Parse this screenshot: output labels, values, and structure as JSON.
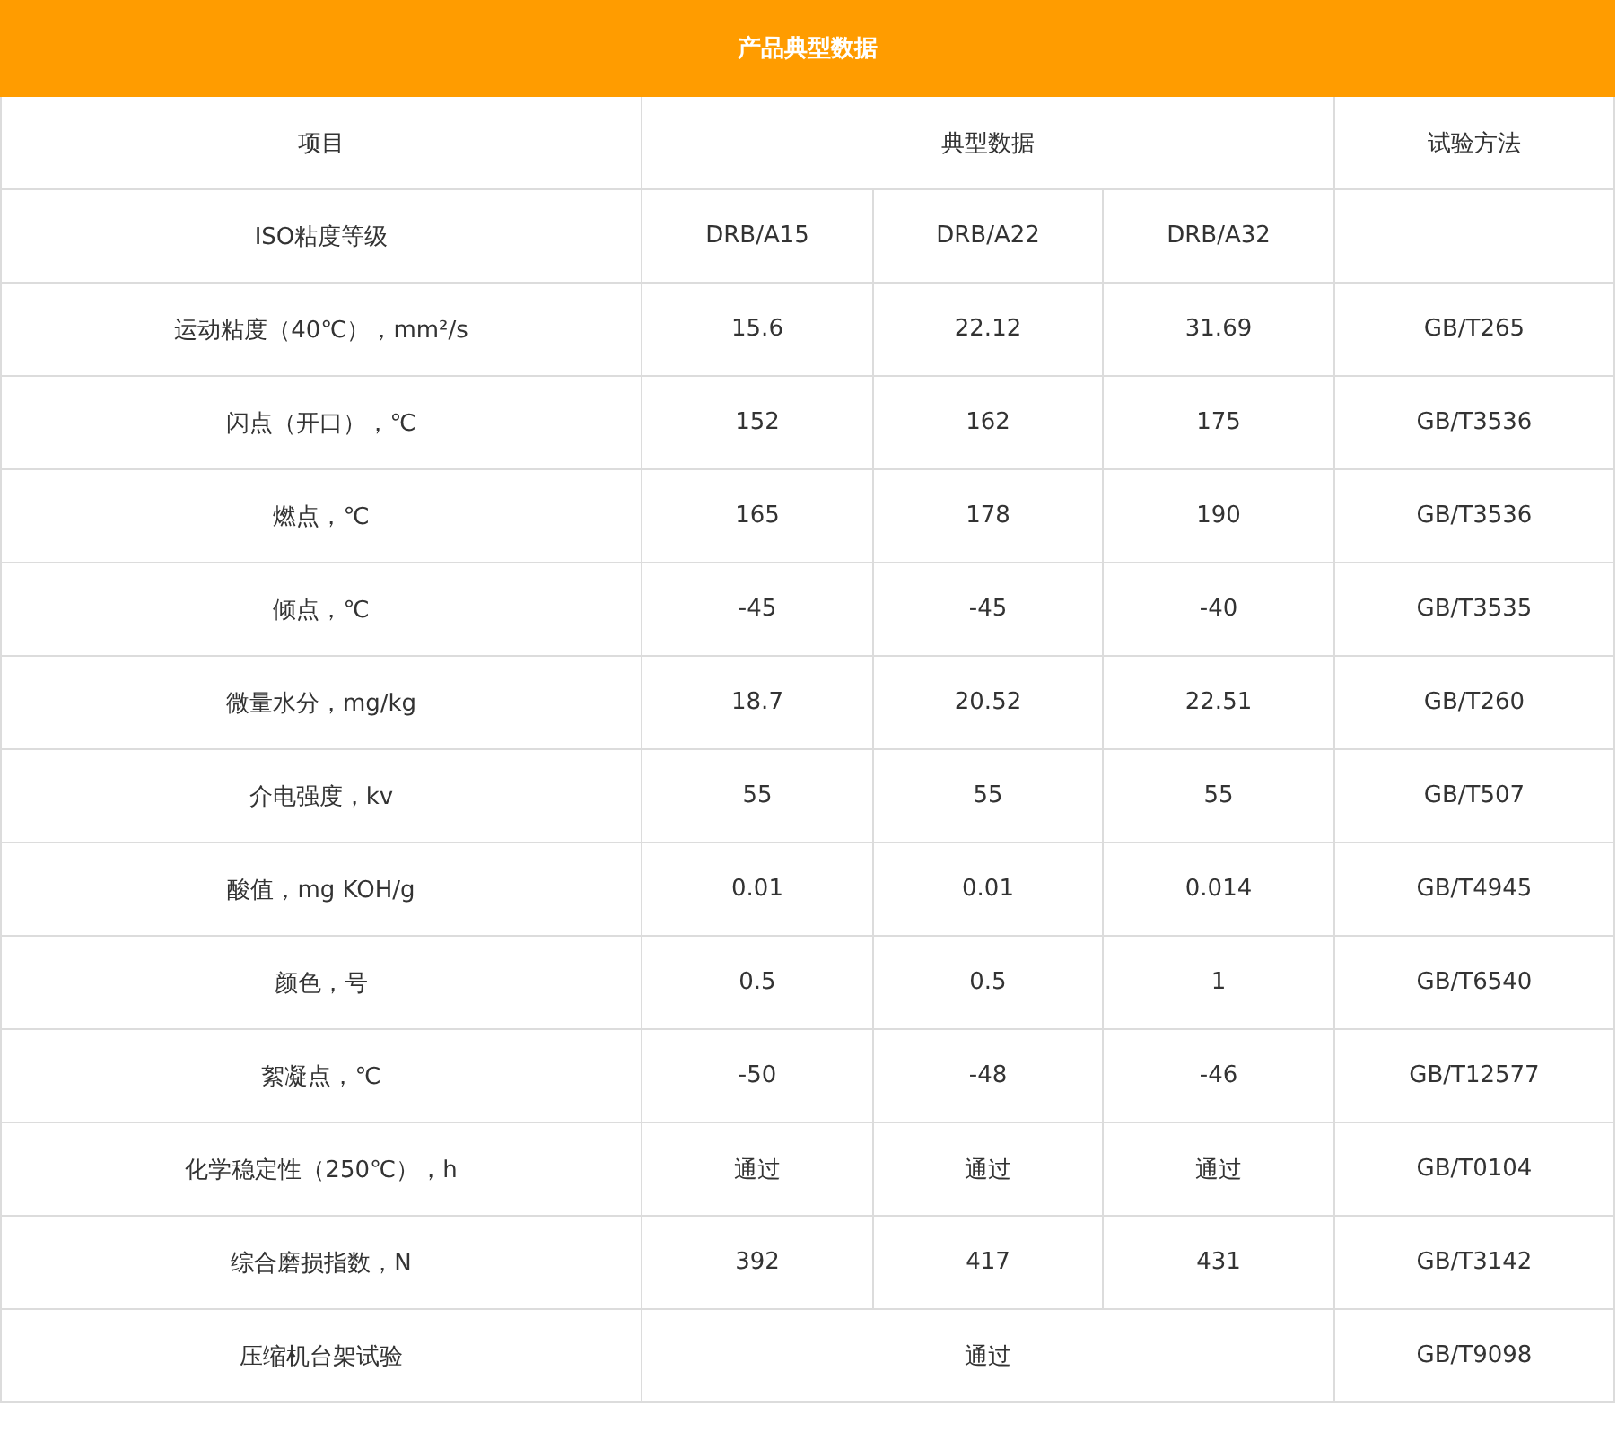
{
  "table": {
    "title": "产品典型数据",
    "header": {
      "item": "项目",
      "typical": "典型数据",
      "method": "试验方法"
    },
    "grades": {
      "label": "ISO粘度等级",
      "values": [
        "DRB/A15",
        "DRB/A22",
        "DRB/A32"
      ]
    },
    "rows": [
      {
        "kind": "values",
        "label": "运动粘度（40℃），mm²/s",
        "values": [
          "15.6",
          "22.12",
          "31.69"
        ],
        "method": "GB/T265"
      },
      {
        "kind": "values",
        "label": "闪点（开口），℃",
        "values": [
          "152",
          "162",
          "175"
        ],
        "method": "GB/T3536"
      },
      {
        "kind": "values",
        "label": "燃点，℃",
        "values": [
          "165",
          "178",
          "190"
        ],
        "method": "GB/T3536"
      },
      {
        "kind": "values",
        "label": "倾点，℃",
        "values": [
          "-45",
          "-45",
          "-40"
        ],
        "method": "GB/T3535"
      },
      {
        "kind": "values",
        "label": "微量水分，mg/kg",
        "values": [
          "18.7",
          "20.52",
          "22.51"
        ],
        "method": "GB/T260"
      },
      {
        "kind": "values",
        "label": "介电强度，kv",
        "values": [
          "55",
          "55",
          "55"
        ],
        "method": "GB/T507"
      },
      {
        "kind": "values",
        "label": "酸值，mg KOH/g",
        "values": [
          "0.01",
          "0.01",
          "0.014"
        ],
        "method": "GB/T4945"
      },
      {
        "kind": "values",
        "label": "颜色，号",
        "values": [
          "0.5",
          "0.5",
          "1"
        ],
        "method": "GB/T6540"
      },
      {
        "kind": "values",
        "label": "絮凝点，℃",
        "values": [
          "-50",
          "-48",
          "-46"
        ],
        "method": "GB/T12577"
      },
      {
        "kind": "values",
        "label": "化学稳定性（250℃），h",
        "values": [
          "通过",
          "通过",
          "通过"
        ],
        "method": "GB/T0104"
      },
      {
        "kind": "values",
        "label": "综合磨损指数，N",
        "values": [
          "392",
          "417",
          "431"
        ],
        "method": "GB/T3142"
      },
      {
        "kind": "merged",
        "label": "压缩机台架试验",
        "values": [
          "通过"
        ],
        "method": "GB/T9098"
      }
    ]
  }
}
